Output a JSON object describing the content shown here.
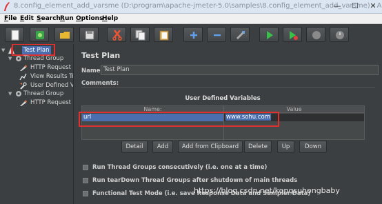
{
  "window": {
    "title": "8.config_element_add_varsme (D:\\program\\apache-jmeter-5.0\\samples\\8.config_element_add_varsme) - Apac...",
    "minimize": "—",
    "maximize": "☐",
    "close": "✕"
  },
  "menu": [
    {
      "label": "File",
      "mnemonic": "F"
    },
    {
      "label": "Edit",
      "mnemonic": "E"
    },
    {
      "label": "Search",
      "mnemonic": "S"
    },
    {
      "label": "Run",
      "mnemonic": "R"
    },
    {
      "label": "Options",
      "mnemonic": "O"
    },
    {
      "label": "Help",
      "mnemonic": "H"
    }
  ],
  "toolbar": {
    "buttons": [
      "new-icon",
      "templates-icon",
      "open-icon",
      "save-icon",
      "cut-icon",
      "copy-icon",
      "paste-icon",
      "expand-icon",
      "collapse-icon",
      "toggle-icon",
      "start-icon",
      "start-no-pause-icon",
      "stop-icon",
      "shutdown-icon"
    ]
  },
  "tree": {
    "nodes": [
      {
        "label": "Test Plan",
        "icon": "testplan-icon"
      },
      {
        "label": "Thread Group",
        "icon": "gear-icon"
      },
      {
        "label": "HTTP Request",
        "icon": "pen-icon"
      },
      {
        "label": "View Results Tre",
        "icon": "chart-icon"
      },
      {
        "label": "User Defined Va",
        "icon": "wrench-icon"
      },
      {
        "label": "Thread Group",
        "icon": "gear-icon"
      },
      {
        "label": "HTTP Request",
        "icon": "pen-icon"
      }
    ]
  },
  "main": {
    "title": "Test Plan",
    "name_label": "Name:",
    "name_value": "Test Plan",
    "comments_label": "Comments:",
    "udv_title": "User Defined Variables",
    "columns": [
      "Name:",
      "Value"
    ],
    "rows": [
      {
        "name": "url",
        "value": "www.sohu.com"
      }
    ],
    "buttons": [
      "Detail",
      "Add",
      "Add from Clipboard",
      "Delete",
      "Up",
      "Down"
    ],
    "checkboxes": [
      "Run Thread Groups consecutively (i.e. one at a time)",
      "Run tearDown Thread Groups after shutdown of main threads",
      "Functional Test Mode (i.e. save Response Data and Sampler Data)"
    ]
  },
  "watermark": "https://blog.csdn.net/kongsuhongbaby",
  "colors": {
    "background": "#3c3f41",
    "selection": "#4b6eaf",
    "highlight_box": "#e03030"
  }
}
